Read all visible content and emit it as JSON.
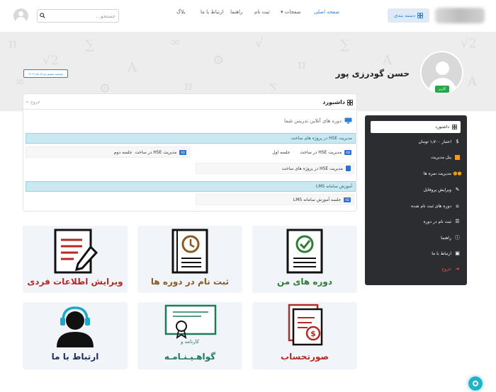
{
  "topbar": {
    "search_placeholder": "جستجو...",
    "nav": [
      {
        "label": "صفحه اصلی",
        "active": true
      },
      {
        "label": "صفحات",
        "dropdown": true
      },
      {
        "label": "ثبت نام"
      },
      {
        "label": "راهنما"
      },
      {
        "label": "ارتباط با ما"
      },
      {
        "label": "بلاگ"
      }
    ],
    "category_button": "دسته بندی"
  },
  "banner": {
    "date": "دوشنبه ششم مرداد ماه ۱۴۰۳",
    "profile_name": "حسن گودرزی پور",
    "role_badge": "کاربر"
  },
  "dashboard": {
    "title": "داشبورد",
    "logout": "خروج",
    "online_courses_title": "دوره های آنلاین تدریس شما",
    "courses": [
      {
        "title": "مدیریت HSE در پروژه های ساخت",
        "sessions": [
          {
            "label": "مدیریت HSE در ساخت",
            "suffix": "جلسه اول",
            "icon": "ad-badge-icon"
          },
          {
            "label": "مدیریت HSE در ساخت",
            "suffix": "جلسه دوم",
            "icon": "ad-badge-icon"
          },
          {
            "label": "مدیریت HSE در پروژه های ساخت",
            "icon": "document-icon"
          }
        ]
      },
      {
        "title": "آموزش سامانه LMS",
        "sessions": [
          {
            "label": "جلسه آموزش سامانه LMS",
            "icon": "ad-badge-icon"
          }
        ]
      }
    ]
  },
  "sidebar": {
    "items": [
      {
        "label": "داشبورد",
        "icon": "grid-icon",
        "active": true
      },
      {
        "label": "اعتبار ۱٫۷۰۰ تومان",
        "icon": "dollar-icon"
      },
      {
        "label": "پنل مدیریت",
        "icon": "panel-icon"
      },
      {
        "label": "مدیریت نمره ها",
        "icon": "users-icon"
      },
      {
        "label": "ویرایش پروفایل",
        "icon": "user-edit-icon"
      },
      {
        "label": "دوره های ثبت نام شده",
        "icon": "institution-icon"
      },
      {
        "label": "ثبت نام در دوره",
        "icon": "list-icon"
      },
      {
        "label": "راهنما",
        "icon": "info-icon"
      },
      {
        "label": "ارتباط با ما",
        "icon": "message-icon"
      },
      {
        "label": "خروج",
        "icon": "logout-icon",
        "danger": true
      }
    ]
  },
  "tiles": [
    {
      "label": "دوره های من",
      "icon": "check-document-icon"
    },
    {
      "label": "ثبت نام در دوره ها",
      "icon": "clock-document-icon"
    },
    {
      "label": "ویرایش اطلاعات فردی",
      "icon": "edit-document-icon"
    },
    {
      "label": "صورتحساب",
      "icon": "invoice-icon"
    },
    {
      "label": "گواهـیـنـامـه",
      "sublabel": "کارنامه و",
      "icon": "certificate-icon"
    },
    {
      "label": "ارتباط با ما",
      "icon": "support-agent-icon"
    }
  ],
  "colors": {
    "accent": "#2f7fd1",
    "sidebar_bg": "#2b2d31",
    "course_head_bg": "#c9e8ef",
    "tile_bg": "#f1f4f8",
    "danger": "#f05656",
    "badge_green": "#28a745"
  }
}
